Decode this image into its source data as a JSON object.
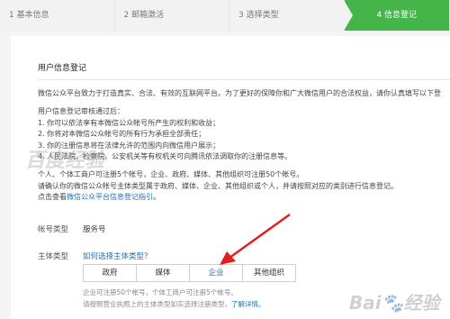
{
  "stepper": {
    "steps": [
      "1 基本信息",
      "2 邮箱激活",
      "3 选择类型",
      "4 信息登记"
    ],
    "active_color": "#44b549"
  },
  "section_title": "用户信息登记",
  "intro": "微信公众平台致力于打造真实、合法、有效的互联网平台。为了更好的保障你和广大微信用户的合法权益，请你认真填写以下登",
  "review_title": "用户信息登记审核通过后：",
  "review_items": [
    "1. 你可以依法享有本微信公众帐号所产生的权利和收益；",
    "2. 你将对本微信公众帐号的所有行为承担全部责任；",
    "3. 你的注册信息将在法律允许的范围内向微信用户展示；",
    "4. 人民法院、检察院、公安机关等有权机关可向腾讯依法调取你的注册信息等。"
  ],
  "notes": [
    "个人、个体工商户可注册5个帐号，企业、政府、媒体、其他组织可注册50个帐号。",
    "请确认你的微信公众帐号主体类型属于政府、媒体、企业、其他组织或个人，并请按照对应的类别进行信息登记。"
  ],
  "guide_prefix": "点击查看",
  "guide_link": "微信公众平台信息登记指引",
  "guide_suffix": "。",
  "account_type_label": "帐号类型",
  "account_type_value": "服务号",
  "subject_type_label": "主体类型",
  "subject_help_link": "如何选择主体类型？",
  "subject_options": [
    "政府",
    "媒体",
    "企业",
    "其他组织"
  ],
  "subject_selected": "企业",
  "hint1": "企业可注册50个帐号，个体工商户可注册5个帐号。",
  "hint2_prefix": "请按照营业执照上的主体类型如实选择注册类型，",
  "hint2_link": "了解详情。",
  "watermark_left": "百度经验",
  "watermark_right": "Bai🐾经验"
}
